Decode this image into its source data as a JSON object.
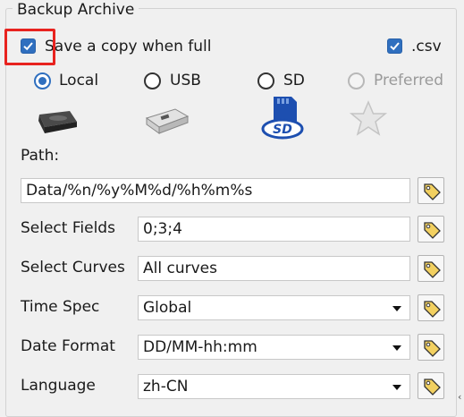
{
  "group": {
    "title": "Backup Archive"
  },
  "save_copy": {
    "label": "Save a copy when full",
    "checked": true
  },
  "csv": {
    "label": ".csv",
    "checked": true
  },
  "targets": [
    {
      "label": "Local",
      "selected": true,
      "enabled": true,
      "icon": "hard-drive-icon"
    },
    {
      "label": "USB",
      "selected": false,
      "enabled": true,
      "icon": "usb-drive-icon"
    },
    {
      "label": "SD",
      "selected": false,
      "enabled": true,
      "icon": "sd-card-icon"
    },
    {
      "label": "Preferred",
      "selected": false,
      "enabled": false,
      "icon": "star-icon"
    }
  ],
  "path": {
    "label": "Path:",
    "value": "Data/%n/%y%M%d/%h%m%s"
  },
  "fields": [
    {
      "label": "Select Fields",
      "value": "0;3;4",
      "type": "text"
    },
    {
      "label": "Select Curves",
      "value": "All curves",
      "type": "text"
    },
    {
      "label": "Time Spec",
      "value": "Global",
      "type": "select"
    },
    {
      "label": "Date Format",
      "value": "DD/MM-hh:mm",
      "type": "select"
    },
    {
      "label": "Language",
      "value": "zh-CN",
      "type": "select"
    }
  ],
  "colors": {
    "accent": "#2f6fbf",
    "highlight": "#e8231f",
    "tag": "#f2d060"
  }
}
